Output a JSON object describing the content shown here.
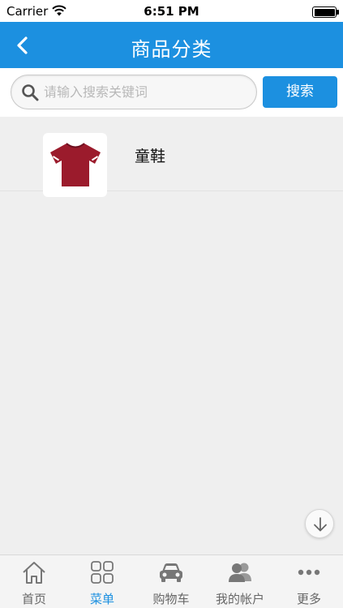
{
  "status_bar": {
    "carrier": "Carrier",
    "time": "6:51 PM"
  },
  "nav": {
    "title": "商品分类",
    "back_icon": "chevron-left-icon"
  },
  "search": {
    "placeholder": "请输入搜索关键词",
    "value": "",
    "button_label": "搜索",
    "icon": "search-icon"
  },
  "categories": [
    {
      "label": "童鞋",
      "icon": "tshirt-icon"
    }
  ],
  "tabs": [
    {
      "label": "首页",
      "icon": "home-icon",
      "active": false
    },
    {
      "label": "菜单",
      "icon": "grid-menu-icon",
      "active": true
    },
    {
      "label": "购物车",
      "icon": "car-icon",
      "active": false
    },
    {
      "label": "我的帐户",
      "icon": "users-icon",
      "active": false
    },
    {
      "label": "更多",
      "icon": "more-dots-icon",
      "active": false
    }
  ],
  "colors": {
    "accent": "#1c90e0",
    "background": "#efefef",
    "shirt": "#9b1b2c"
  }
}
